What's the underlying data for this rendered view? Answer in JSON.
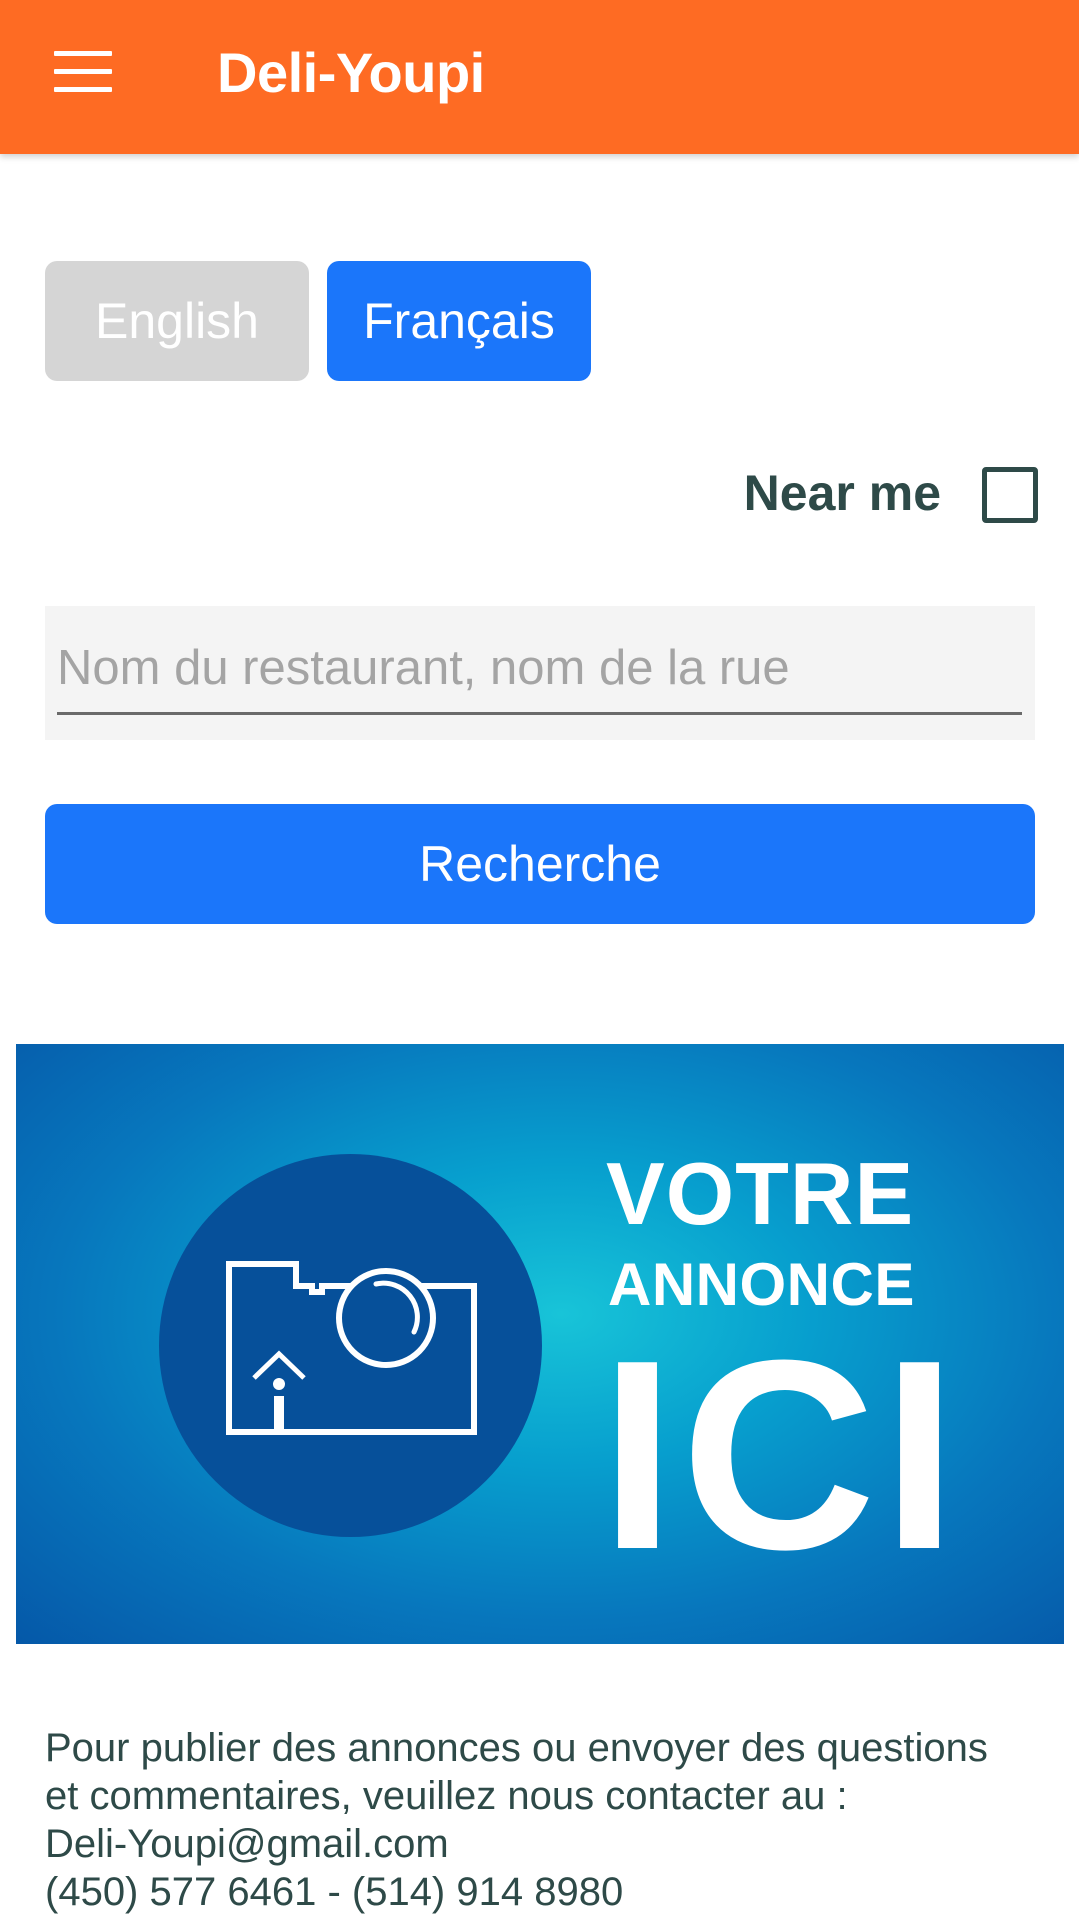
{
  "app_bar": {
    "title": "Deli-Youpi",
    "menu_icon": "hamburger-menu-icon",
    "color": "#fe6b23"
  },
  "language": {
    "english_label": "English",
    "french_label": "Français",
    "selected": "Français",
    "inactive_color": "#d5d5d5",
    "active_color": "#1b76fa"
  },
  "near_me": {
    "label": "Near me",
    "checked": false
  },
  "search": {
    "placeholder": "Nom du restaurant, nom de la rue",
    "value": "",
    "button_label": "Recherche"
  },
  "ad": {
    "line1": "VOTRE",
    "line2": "ANNONCE",
    "line3": "ICI",
    "icon": "camera-house-icon"
  },
  "contact": {
    "line1": "Pour publier des annonces ou envoyer des questions",
    "line2": "et commentaires, veuillez nous contacter au :",
    "email": "Deli-Youpi@gmail.com",
    "phones": "(450) 577 6461 - (514) 914 8980"
  }
}
